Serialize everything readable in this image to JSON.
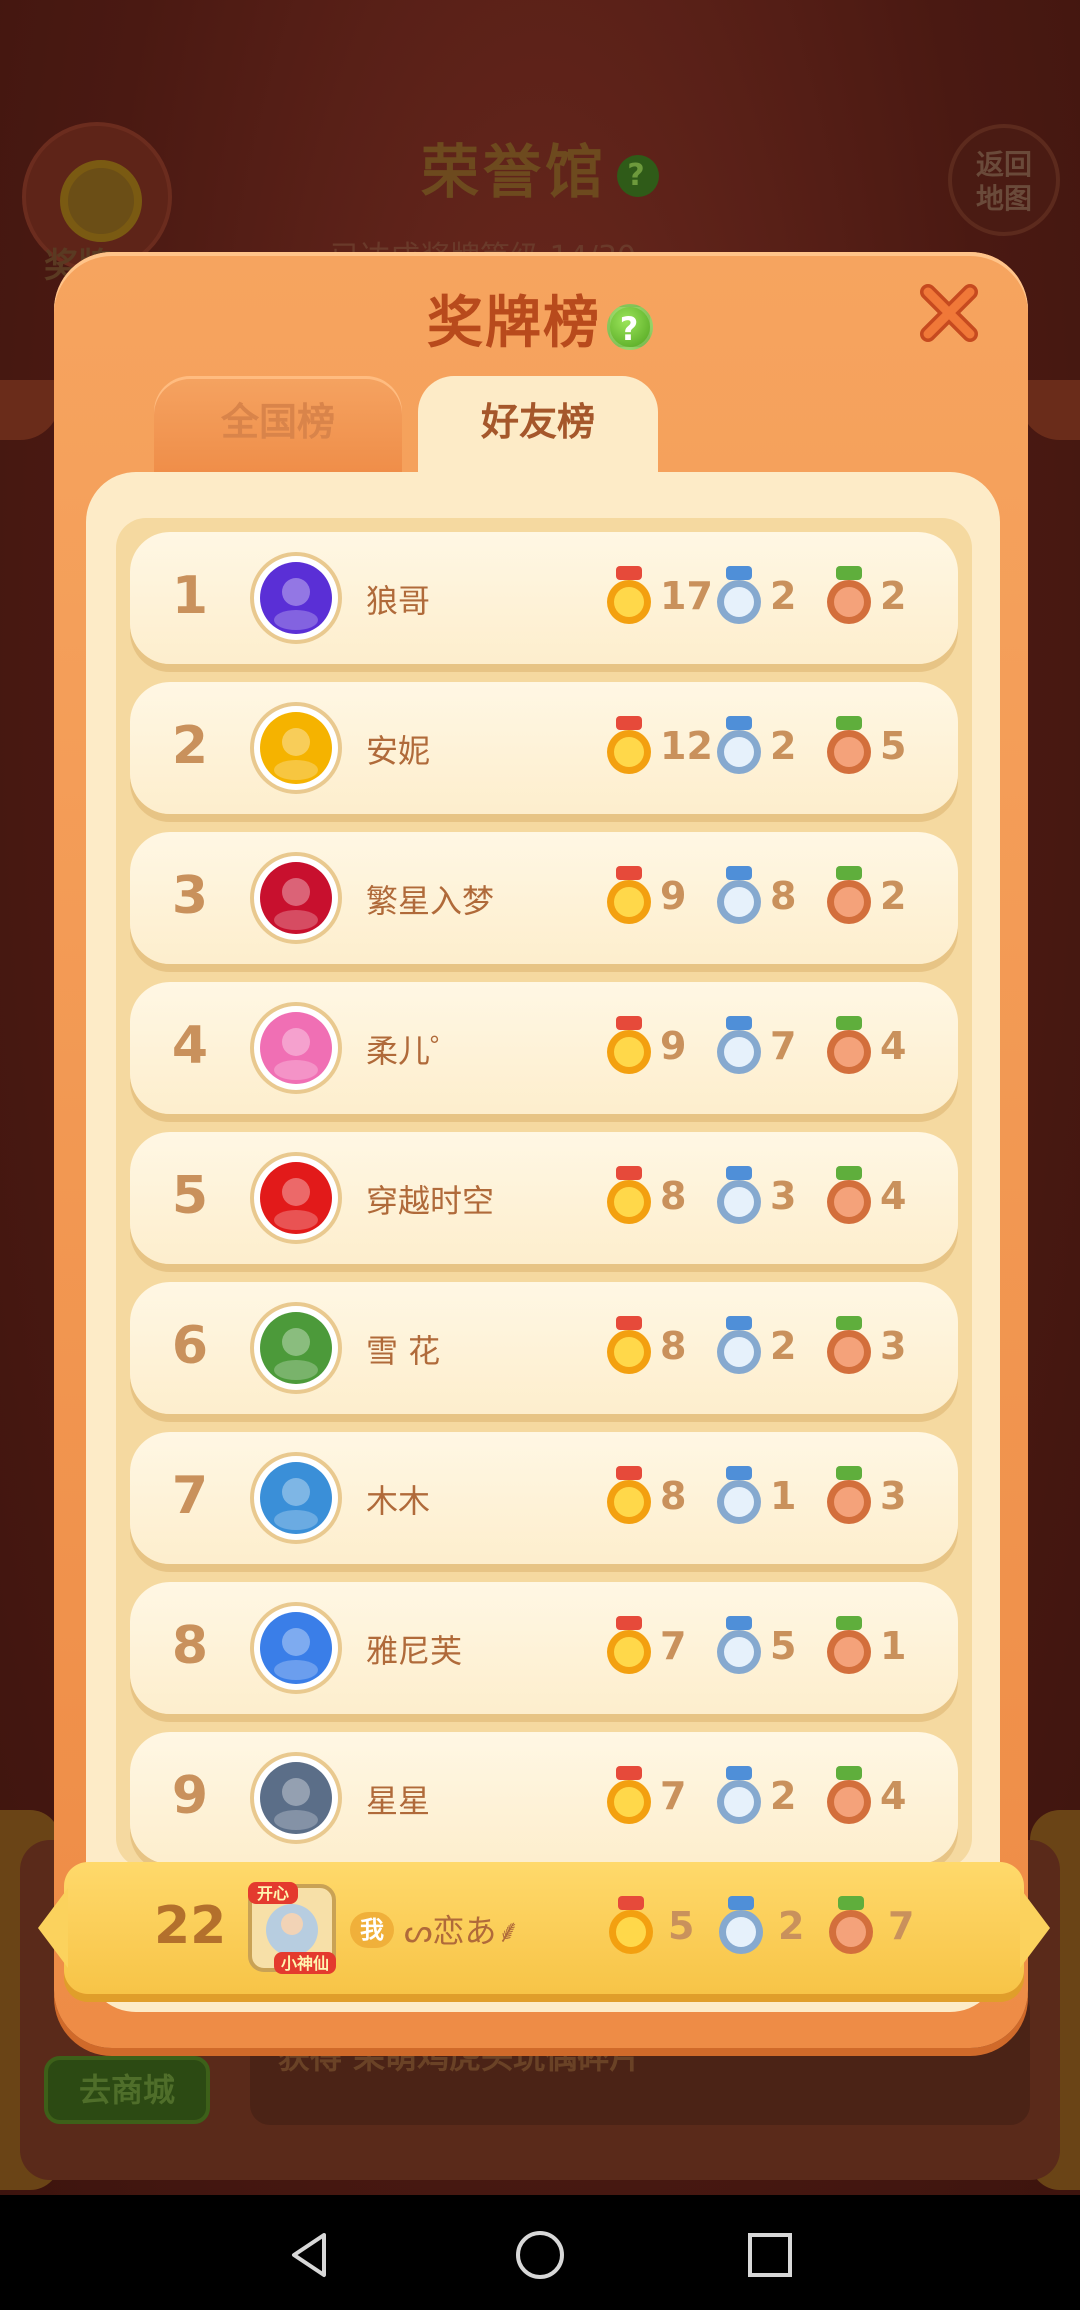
{
  "background": {
    "title": "荣誉馆",
    "subtitle": "已达成奖牌等级    14/30",
    "left_button_label": "奖牌",
    "right_button_label": [
      "返回",
      "地图"
    ],
    "bottom_text": "获得 呆萌鸡虎头玩偶碎片",
    "shop_button": "去商城"
  },
  "modal": {
    "title": "奖牌榜",
    "tabs": [
      {
        "label": "全国榜",
        "active": false
      },
      {
        "label": "好友榜",
        "active": true
      }
    ]
  },
  "leaderboard": [
    {
      "rank": "1",
      "name": "狼哥",
      "gold": "17",
      "silver": "2",
      "bronze": "2",
      "avatar_color": "#5a2fd6"
    },
    {
      "rank": "2",
      "name": "安妮",
      "gold": "12",
      "silver": "2",
      "bronze": "5",
      "avatar_color": "#f5b300"
    },
    {
      "rank": "3",
      "name": "繁星入梦",
      "gold": "9",
      "silver": "8",
      "bronze": "2",
      "avatar_color": "#c8102e"
    },
    {
      "rank": "4",
      "name": "柔儿゜",
      "gold": "9",
      "silver": "7",
      "bronze": "4",
      "avatar_color": "#f06fb4"
    },
    {
      "rank": "5",
      "name": "穿越时空",
      "gold": "8",
      "silver": "3",
      "bronze": "4",
      "avatar_color": "#e21a1a"
    },
    {
      "rank": "6",
      "name": "雪  花",
      "gold": "8",
      "silver": "2",
      "bronze": "3",
      "avatar_color": "#4c9a3a"
    },
    {
      "rank": "7",
      "name": "木木",
      "gold": "8",
      "silver": "1",
      "bronze": "3",
      "avatar_color": "#3a8fd8"
    },
    {
      "rank": "8",
      "name": "雅尼芙",
      "gold": "7",
      "silver": "5",
      "bronze": "1",
      "avatar_color": "#3a7ee8"
    },
    {
      "rank": "9",
      "name": "星星",
      "gold": "7",
      "silver": "2",
      "bronze": "4",
      "avatar_color": "#5b6e88"
    }
  ],
  "self_entry": {
    "rank": "22",
    "me_badge": "我",
    "name": "ᔕ恋あ⸙",
    "gold": "5",
    "silver": "2",
    "bronze": "7",
    "avatar_caption_top": "开心",
    "avatar_caption_bottom": "小神仙"
  },
  "colors": {
    "panel": "#f29a52",
    "row": "#fff4dc",
    "gold_medal": "#f7b81d",
    "silver_medal": "#a9c8e6",
    "bronze_medal": "#e88e5e",
    "self_row": "#fbd25d"
  },
  "icons": {
    "close": "close-x-icon",
    "help": "help-icon",
    "gold": "gold-medal-icon",
    "silver": "silver-medal-icon",
    "bronze": "bronze-medal-icon",
    "nav_back": "back-triangle-icon",
    "nav_home": "home-circle-icon",
    "nav_recent": "recents-square-icon"
  }
}
